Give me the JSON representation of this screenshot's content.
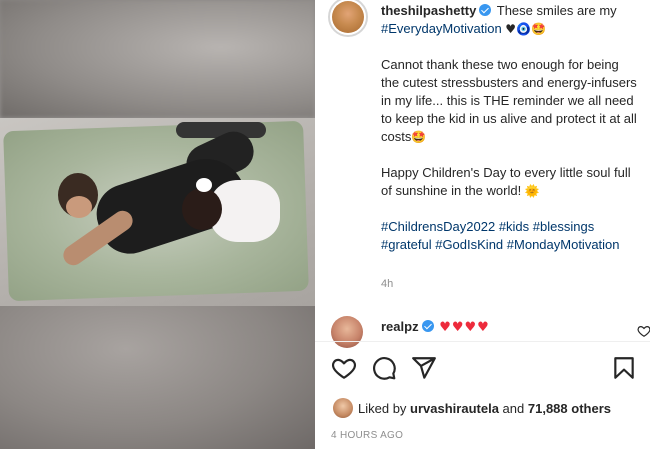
{
  "post": {
    "username": "theshilpashetty",
    "caption_start": "These smiles are my",
    "caption_hashtag_1": "#EverydayMotivation",
    "paragraph_1": "Cannot thank these two enough for being the cutest stressbusters and energy-infusers in my life... this is THE reminder we all need to keep the kid in us alive and protect it at all costs",
    "paragraph_2": "Happy Children's Day to every little soul full of sunshine in the world!",
    "hashtags": [
      "#ChildrensDay2022",
      "#kids",
      "#blessings",
      "#grateful",
      "#GodIsKind",
      "#MondayMotivation"
    ],
    "posted_ago_short": "4h",
    "posted_ago_long": "4 HOURS AGO"
  },
  "emojis": {
    "heart": "♥",
    "evil_eye": "🧿",
    "star_struck": "🤩",
    "sun": "🌞"
  },
  "comment": {
    "username": "realpz",
    "text": "♥♥♥♥"
  },
  "likes": {
    "prefix": "Liked by",
    "user": "urvashirautela",
    "and": "and",
    "count": "71,888 others"
  },
  "icons": [
    "verified-badge-icon",
    "heart-outline-icon",
    "comment-icon",
    "share-icon",
    "bookmark-icon"
  ],
  "colors": {
    "hashtag": "#00376b",
    "verified": "#3897f0",
    "secondary_text": "#8e8e8e",
    "heart_red": "#ed2b3c"
  }
}
